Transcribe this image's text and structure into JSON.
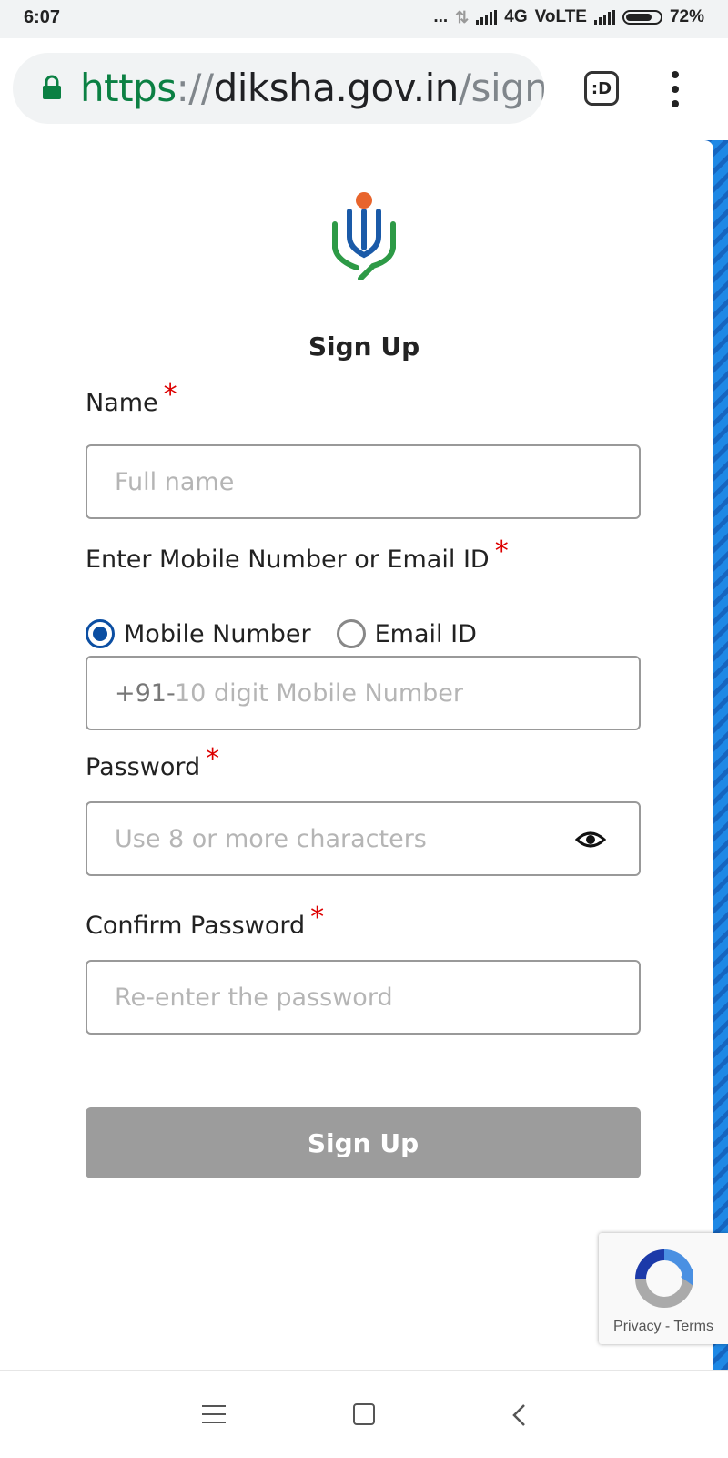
{
  "status_bar": {
    "time": "6:07",
    "dots": "...",
    "network": "4G",
    "volte": "VoLTE",
    "battery": "72%"
  },
  "browser": {
    "url_scheme": "https",
    "url_sep": "://",
    "url_host": "diksha.gov.in",
    "url_path": "/signu",
    "tab_icon_label": ":D",
    "icons": [
      "lock-icon",
      "tab-switcher-icon",
      "menu-icon"
    ]
  },
  "form": {
    "title": "Sign Up",
    "name_label": "Name",
    "name_placeholder": "Full name",
    "contact_label": "Enter Mobile Number or Email ID",
    "radio_mobile": "Mobile Number",
    "radio_email": "Email ID",
    "selected_contact": "Mobile Number",
    "mobile_prefix": "+91-",
    "mobile_placeholder": "10 digit Mobile Number",
    "password_label": "Password",
    "password_placeholder": "Use 8 or more characters",
    "confirm_label": "Confirm Password",
    "confirm_placeholder": "Re-enter the password",
    "required_mark": "*",
    "submit_label": "Sign Up"
  },
  "recaptcha": {
    "privacy": "Privacy",
    "sep": " - ",
    "terms": "Terms"
  },
  "colors": {
    "url_scheme": "#0b8043",
    "required": "#dd0000",
    "radio_selected": "#0b4ea2",
    "button_disabled": "#9c9c9c",
    "logo_orange": "#e8642c",
    "logo_blue": "#1a5aa8",
    "logo_green": "#2d9a46",
    "deco_blue": "#1e88e5",
    "deco_teal": "#2aa88a"
  }
}
